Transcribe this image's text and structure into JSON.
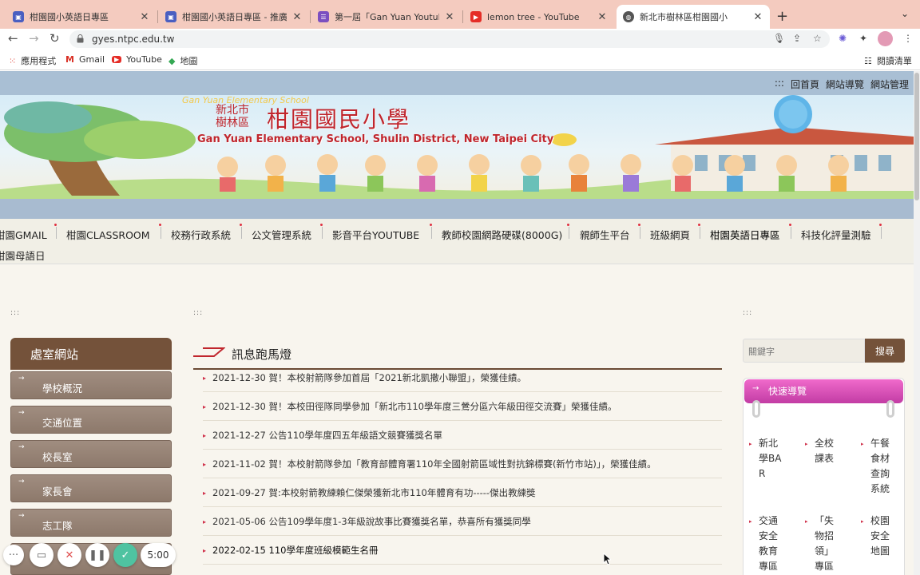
{
  "browser": {
    "tabs": [
      {
        "title": "柑園國小英語日專區",
        "favicon": "site-icon",
        "active": false
      },
      {
        "title": "柑園國小英語日專區 - 推廣",
        "favicon": "site-icon",
        "active": false
      },
      {
        "title": "第一屆「Gan Yuan Youtuber」",
        "favicon": "form-icon",
        "active": false
      },
      {
        "title": "lemon tree - YouTube",
        "favicon": "youtube-icon",
        "active": false
      },
      {
        "title": "新北市樹林區柑園國小",
        "favicon": "globe-icon",
        "active": true
      }
    ],
    "url": "gyes.ntpc.edu.tw",
    "bookmarks": [
      {
        "label": "應用程式",
        "icon": "apps-grid-icon"
      },
      {
        "label": "Gmail",
        "icon": "gmail-icon"
      },
      {
        "label": "YouTube",
        "icon": "youtube-icon"
      },
      {
        "label": "地圖",
        "icon": "maps-icon"
      }
    ],
    "reading_list": "閱讀清單"
  },
  "site": {
    "top_links": [
      ":::",
      "回首頁",
      "網站導覽",
      "網站管理"
    ],
    "banner": {
      "title_small_1": "新北市",
      "title_small_2": "樹林區",
      "title_big": "柑園國民小學",
      "subtitle": "Gan Yuan Elementary School, Shulin District, New Taipei City",
      "arc_text": "Gan Yuan Elementary School"
    },
    "menu": [
      "柑園GMAIL",
      "柑園CLASSROOM",
      "校務行政系統",
      "公文管理系統",
      "影音平台YOUTUBE",
      "教師校園網路硬碟(8000G)",
      "親師生平台",
      "班級網頁",
      "柑園英語日專區",
      "科技化評量測驗",
      "柑園母語日"
    ],
    "triple_colon": ":::",
    "sidebar": {
      "heading": "處室網站",
      "items": [
        "學校概況",
        "交通位置",
        "校長室",
        "家長會",
        "志工隊"
      ]
    },
    "news": {
      "heading": "訊息跑馬燈",
      "items": [
        "2021-12-30 賀！本校射箭隊參加首屆「2021新北凱撒小聯盟」，榮獲佳績。",
        "2021-12-30 賀！本校田徑隊同學參加「新北市110學年度三鶯分區六年級田徑交流賽」榮獲佳績。",
        "2021-12-27 公告110學年度四五年級語文競賽獲獎名單",
        "2021-11-02 賀！本校射箭隊參加「教育部體育署110年全國射箭區域性對抗錦標賽(新竹市站)」，榮獲佳績。",
        "2021-09-27 賀:本校射箭教練賴仁傑榮獲新北市110年體育有功-----傑出教練獎",
        "2021-05-06 公告109學年度1-3年級說故事比賽獲獎名單，恭喜所有獲獎同學",
        "2022-02-15 110學年度班級模範生名冊"
      ]
    },
    "search": {
      "placeholder": "關鍵字",
      "button": "搜尋"
    },
    "quick_nav": {
      "heading": "快速導覽",
      "items": [
        "新北學BAR",
        "全校課表",
        "午餐食材查詢系統",
        "交通安全教育專區",
        "「失物招領」專區",
        "校園安全地圖"
      ]
    }
  },
  "recorder": {
    "timer": "5:00"
  },
  "colors": {
    "brown": "#74523a",
    "pink": "#d94bb4",
    "tabbar": "#f4cbbf",
    "red_bullet": "#d0304a"
  }
}
